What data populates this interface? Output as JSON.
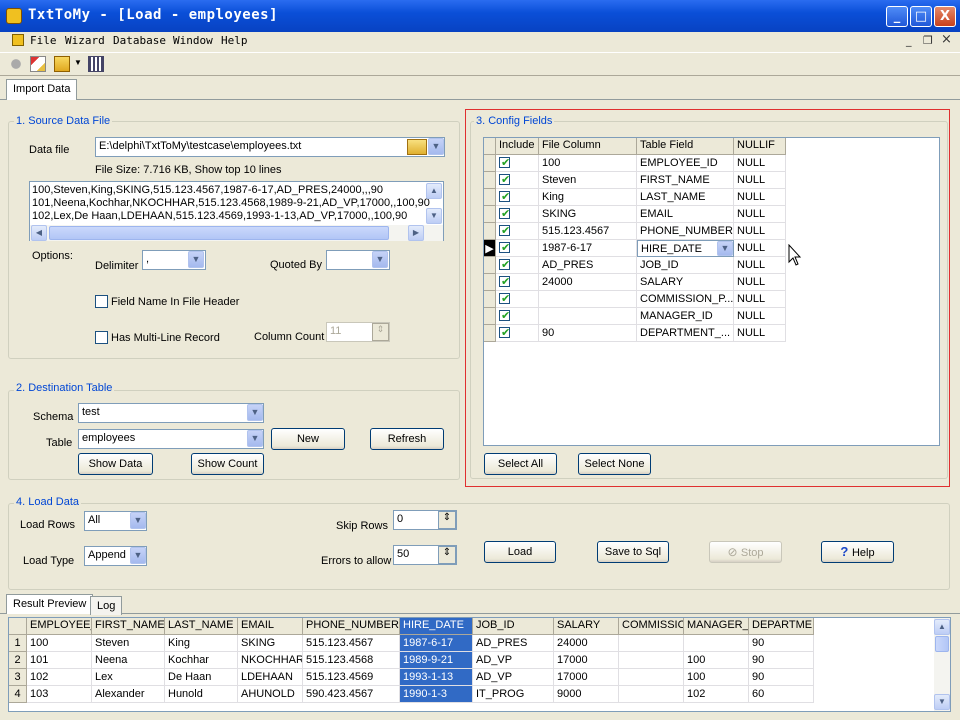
{
  "window": {
    "title": "TxtToMy - [Load - employees]",
    "minimize": "_",
    "maximize": "□",
    "close": "X"
  },
  "menu": [
    "File",
    "Wizard",
    "Database",
    "Window",
    "Help"
  ],
  "mdi": {
    "min": "_",
    "restore": "❐",
    "close": "×"
  },
  "tabs": {
    "import": "Import Data",
    "result": "Result Preview",
    "log": "Log"
  },
  "source": {
    "label": "1. Source Data File",
    "data_file_label": "Data file",
    "data_file": "E:\\delphi\\TxtToMy\\testcase\\employees.txt",
    "file_size": "File Size: 7.716 KB,  Show top 10 lines",
    "preview": [
      "100,Steven,King,SKING,515.123.4567,1987-6-17,AD_PRES,24000,,,90",
      "101,Neena,Kochhar,NKOCHHAR,515.123.4568,1989-9-21,AD_VP,17000,,100,90",
      "102,Lex,De Haan,LDEHAAN,515.123.4569,1993-1-13,AD_VP,17000,,100,90"
    ],
    "options_label": "Options:",
    "delimiter_label": "Delimiter",
    "delimiter": ",",
    "quoted_label": "Quoted By",
    "quoted": "",
    "field_name_header": "Field Name In File Header",
    "multiline": "Has Multi-Line Record",
    "column_count_label": "Column Count",
    "column_count": "11"
  },
  "dest": {
    "label": "2. Destination Table",
    "schema_label": "Schema",
    "schema": "test",
    "table_label": "Table",
    "table": "employees",
    "new": "New",
    "refresh": "Refresh",
    "show_data": "Show Data",
    "show_count": "Show Count"
  },
  "config": {
    "label": "3. Config Fields",
    "headers": [
      "Include",
      "File Column",
      "Table Field",
      "NULLIF"
    ],
    "rows": [
      {
        "file": "100",
        "field": "EMPLOYEE_ID",
        "nullif": "NULL"
      },
      {
        "file": "Steven",
        "field": "FIRST_NAME",
        "nullif": "NULL"
      },
      {
        "file": "King",
        "field": "LAST_NAME",
        "nullif": "NULL"
      },
      {
        "file": "SKING",
        "field": "EMAIL",
        "nullif": "NULL"
      },
      {
        "file": "515.123.4567",
        "field": "PHONE_NUMBER",
        "nullif": "NULL"
      },
      {
        "file": "1987-6-17",
        "field": "HIRE_DATE",
        "nullif": "NULL"
      },
      {
        "file": "AD_PRES",
        "field": "JOB_ID",
        "nullif": "NULL"
      },
      {
        "file": "24000",
        "field": "SALARY",
        "nullif": "NULL"
      },
      {
        "file": "",
        "field": "COMMISSION_P...",
        "nullif": "NULL"
      },
      {
        "file": "",
        "field": "MANAGER_ID",
        "nullif": "NULL"
      },
      {
        "file": "90",
        "field": "DEPARTMENT_...",
        "nullif": "NULL"
      }
    ],
    "select_all": "Select All",
    "select_none": "Select None"
  },
  "load": {
    "label": "4. Load Data",
    "rows_label": "Load Rows",
    "rows": "All",
    "type_label": "Load Type",
    "type": "Append",
    "skip_label": "Skip Rows",
    "skip": "0",
    "errors_label": "Errors to allow",
    "errors": "50",
    "load_btn": "Load",
    "save_sql": "Save to Sql",
    "stop": "Stop",
    "help": "Help"
  },
  "result": {
    "headers": [
      "EMPLOYEE_",
      "FIRST_NAME",
      "LAST_NAME",
      "EMAIL",
      "PHONE_NUMBER",
      "HIRE_DATE",
      "JOB_ID",
      "SALARY",
      "COMMISSIO",
      "MANAGER_I",
      "DEPARTME"
    ],
    "rows": [
      [
        "1",
        "100",
        "Steven",
        "King",
        "SKING",
        "515.123.4567",
        "1987-6-17",
        "AD_PRES",
        "24000",
        "",
        "",
        "90"
      ],
      [
        "2",
        "101",
        "Neena",
        "Kochhar",
        "NKOCHHAR",
        "515.123.4568",
        "1989-9-21",
        "AD_VP",
        "17000",
        "",
        "100",
        "90"
      ],
      [
        "3",
        "102",
        "Lex",
        "De Haan",
        "LDEHAAN",
        "515.123.4569",
        "1993-1-13",
        "AD_VP",
        "17000",
        "",
        "100",
        "90"
      ],
      [
        "4",
        "103",
        "Alexander",
        "Hunold",
        "AHUNOLD",
        "590.423.4567",
        "1990-1-3",
        "IT_PROG",
        "9000",
        "",
        "102",
        "60"
      ]
    ]
  }
}
